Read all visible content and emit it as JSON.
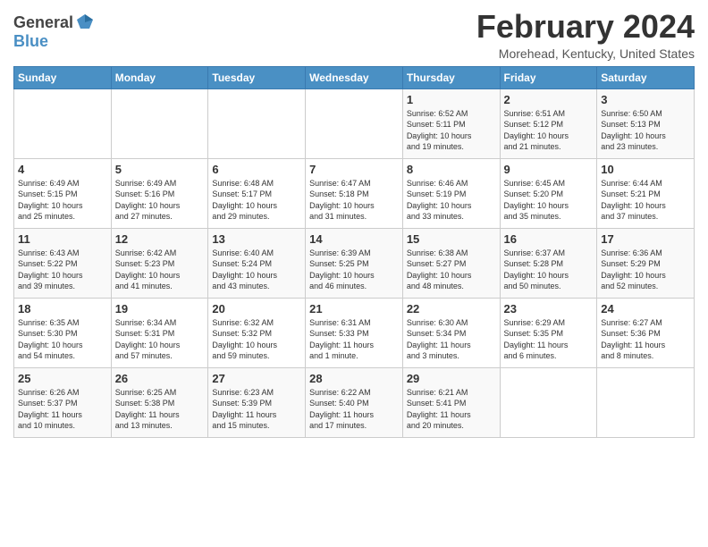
{
  "header": {
    "logo_general": "General",
    "logo_blue": "Blue",
    "month": "February 2024",
    "location": "Morehead, Kentucky, United States"
  },
  "days_of_week": [
    "Sunday",
    "Monday",
    "Tuesday",
    "Wednesday",
    "Thursday",
    "Friday",
    "Saturday"
  ],
  "weeks": [
    [
      {
        "day": "",
        "info": ""
      },
      {
        "day": "",
        "info": ""
      },
      {
        "day": "",
        "info": ""
      },
      {
        "day": "",
        "info": ""
      },
      {
        "day": "1",
        "info": "Sunrise: 6:52 AM\nSunset: 5:11 PM\nDaylight: 10 hours\nand 19 minutes."
      },
      {
        "day": "2",
        "info": "Sunrise: 6:51 AM\nSunset: 5:12 PM\nDaylight: 10 hours\nand 21 minutes."
      },
      {
        "day": "3",
        "info": "Sunrise: 6:50 AM\nSunset: 5:13 PM\nDaylight: 10 hours\nand 23 minutes."
      }
    ],
    [
      {
        "day": "4",
        "info": "Sunrise: 6:49 AM\nSunset: 5:15 PM\nDaylight: 10 hours\nand 25 minutes."
      },
      {
        "day": "5",
        "info": "Sunrise: 6:49 AM\nSunset: 5:16 PM\nDaylight: 10 hours\nand 27 minutes."
      },
      {
        "day": "6",
        "info": "Sunrise: 6:48 AM\nSunset: 5:17 PM\nDaylight: 10 hours\nand 29 minutes."
      },
      {
        "day": "7",
        "info": "Sunrise: 6:47 AM\nSunset: 5:18 PM\nDaylight: 10 hours\nand 31 minutes."
      },
      {
        "day": "8",
        "info": "Sunrise: 6:46 AM\nSunset: 5:19 PM\nDaylight: 10 hours\nand 33 minutes."
      },
      {
        "day": "9",
        "info": "Sunrise: 6:45 AM\nSunset: 5:20 PM\nDaylight: 10 hours\nand 35 minutes."
      },
      {
        "day": "10",
        "info": "Sunrise: 6:44 AM\nSunset: 5:21 PM\nDaylight: 10 hours\nand 37 minutes."
      }
    ],
    [
      {
        "day": "11",
        "info": "Sunrise: 6:43 AM\nSunset: 5:22 PM\nDaylight: 10 hours\nand 39 minutes."
      },
      {
        "day": "12",
        "info": "Sunrise: 6:42 AM\nSunset: 5:23 PM\nDaylight: 10 hours\nand 41 minutes."
      },
      {
        "day": "13",
        "info": "Sunrise: 6:40 AM\nSunset: 5:24 PM\nDaylight: 10 hours\nand 43 minutes."
      },
      {
        "day": "14",
        "info": "Sunrise: 6:39 AM\nSunset: 5:25 PM\nDaylight: 10 hours\nand 46 minutes."
      },
      {
        "day": "15",
        "info": "Sunrise: 6:38 AM\nSunset: 5:27 PM\nDaylight: 10 hours\nand 48 minutes."
      },
      {
        "day": "16",
        "info": "Sunrise: 6:37 AM\nSunset: 5:28 PM\nDaylight: 10 hours\nand 50 minutes."
      },
      {
        "day": "17",
        "info": "Sunrise: 6:36 AM\nSunset: 5:29 PM\nDaylight: 10 hours\nand 52 minutes."
      }
    ],
    [
      {
        "day": "18",
        "info": "Sunrise: 6:35 AM\nSunset: 5:30 PM\nDaylight: 10 hours\nand 54 minutes."
      },
      {
        "day": "19",
        "info": "Sunrise: 6:34 AM\nSunset: 5:31 PM\nDaylight: 10 hours\nand 57 minutes."
      },
      {
        "day": "20",
        "info": "Sunrise: 6:32 AM\nSunset: 5:32 PM\nDaylight: 10 hours\nand 59 minutes."
      },
      {
        "day": "21",
        "info": "Sunrise: 6:31 AM\nSunset: 5:33 PM\nDaylight: 11 hours\nand 1 minute."
      },
      {
        "day": "22",
        "info": "Sunrise: 6:30 AM\nSunset: 5:34 PM\nDaylight: 11 hours\nand 3 minutes."
      },
      {
        "day": "23",
        "info": "Sunrise: 6:29 AM\nSunset: 5:35 PM\nDaylight: 11 hours\nand 6 minutes."
      },
      {
        "day": "24",
        "info": "Sunrise: 6:27 AM\nSunset: 5:36 PM\nDaylight: 11 hours\nand 8 minutes."
      }
    ],
    [
      {
        "day": "25",
        "info": "Sunrise: 6:26 AM\nSunset: 5:37 PM\nDaylight: 11 hours\nand 10 minutes."
      },
      {
        "day": "26",
        "info": "Sunrise: 6:25 AM\nSunset: 5:38 PM\nDaylight: 11 hours\nand 13 minutes."
      },
      {
        "day": "27",
        "info": "Sunrise: 6:23 AM\nSunset: 5:39 PM\nDaylight: 11 hours\nand 15 minutes."
      },
      {
        "day": "28",
        "info": "Sunrise: 6:22 AM\nSunset: 5:40 PM\nDaylight: 11 hours\nand 17 minutes."
      },
      {
        "day": "29",
        "info": "Sunrise: 6:21 AM\nSunset: 5:41 PM\nDaylight: 11 hours\nand 20 minutes."
      },
      {
        "day": "",
        "info": ""
      },
      {
        "day": "",
        "info": ""
      }
    ]
  ]
}
